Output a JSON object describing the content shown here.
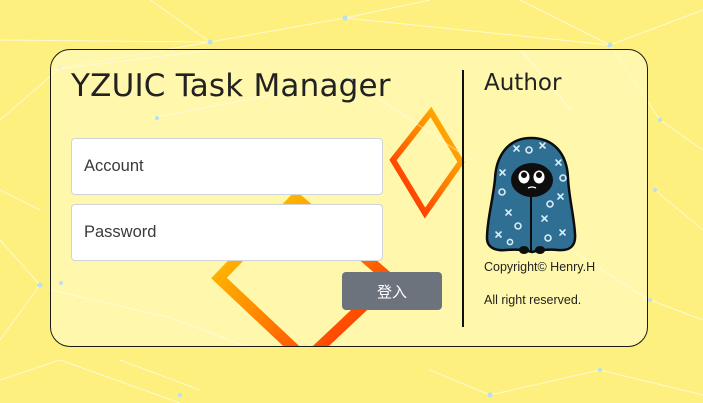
{
  "app": {
    "title": "YZUIC Task Manager"
  },
  "login_form": {
    "account_placeholder": "Account",
    "password_placeholder": "Password",
    "submit_label": "登入"
  },
  "author_panel": {
    "heading": "Author",
    "copyright": "Copyright© Henry.H",
    "rights": "All right reserved."
  },
  "colors": {
    "background": "#fdf07e",
    "card_background": "#fffac0",
    "button": "#6c737c",
    "decoration_gradient": [
      "#ffd400",
      "#ff8c00",
      "#ff1a00"
    ],
    "network_lines": "#ffffff"
  },
  "icons": {
    "avatar": "hooded-character-icon"
  }
}
